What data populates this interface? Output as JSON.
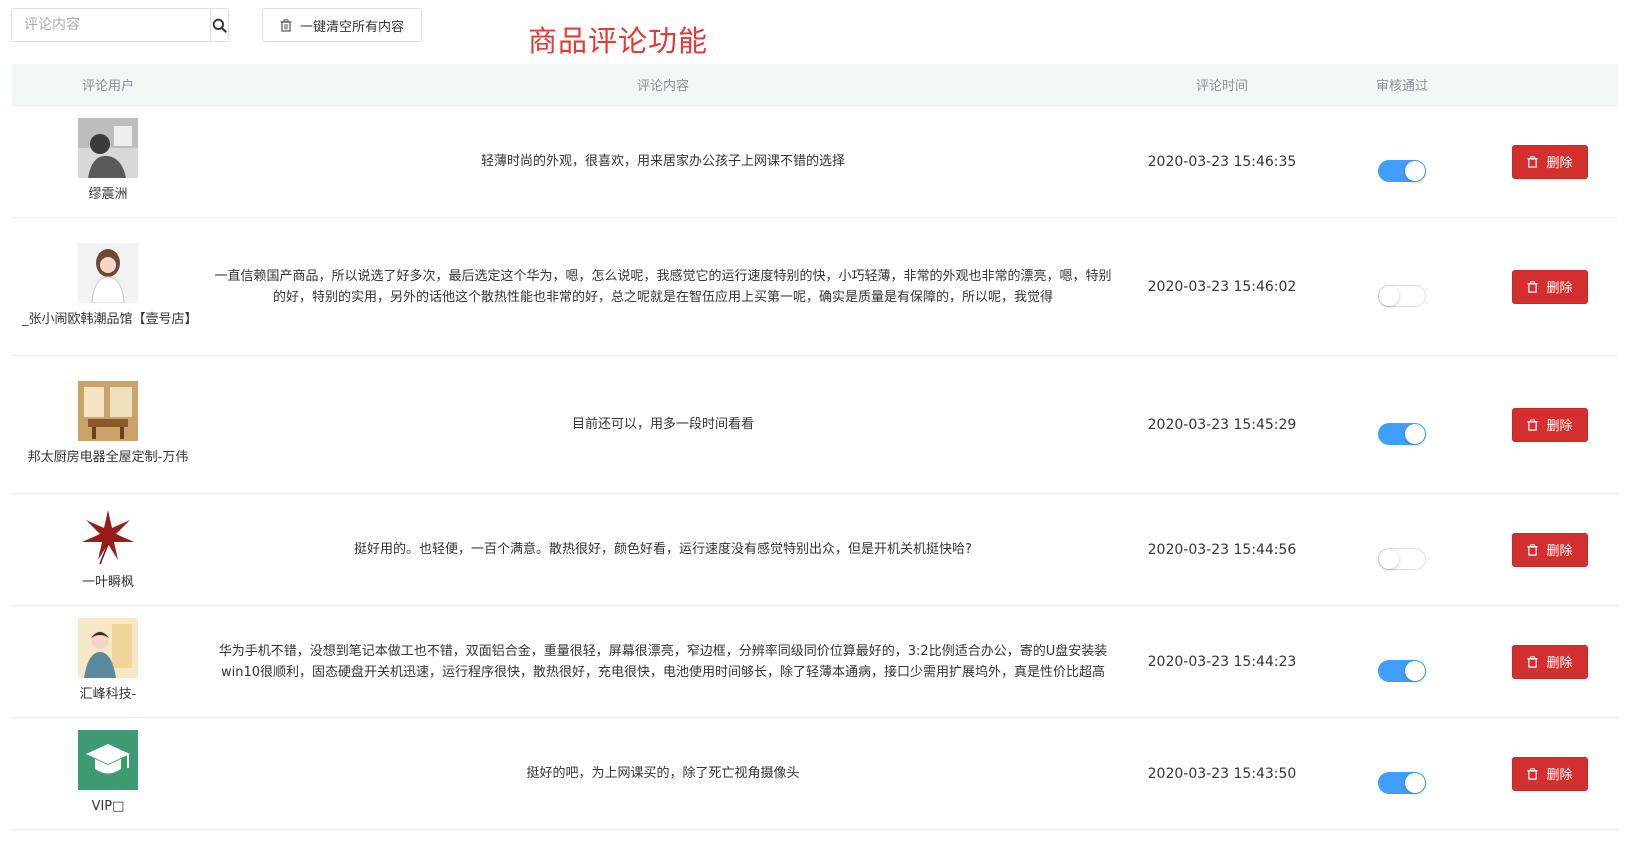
{
  "search": {
    "placeholder": "评论内容",
    "icon": "search-icon"
  },
  "toolbar": {
    "clear_label": "一键清空所有内容",
    "clear_icon": "trash-icon"
  },
  "page_title": "商品评论功能",
  "table": {
    "headers": {
      "user": "评论用户",
      "content": "评论内容",
      "time": "评论时间",
      "audit": "审核通过"
    },
    "delete_label": "删除",
    "rows": [
      {
        "user": "缪震洲",
        "content": "轻薄时尚的外观，很喜欢，用来居家办公孩子上网课不错的选择",
        "time": "2020-03-23 15:46:35",
        "approved": true
      },
      {
        "user": "_张小闹欧韩潮品馆【壹号店】",
        "content": "一直信赖国产商品，所以说选了好多次，最后选定这个华为，嗯，怎么说呢，我感觉它的运行速度特别的快，小巧轻薄，非常的外观也非常的漂亮，嗯，特别的好，特别的实用，另外的话他这个散热性能也非常的好，总之呢就是在智伍应用上买第一呢，确实是质量是有保障的，所以呢，我觉得",
        "time": "2020-03-23 15:46:02",
        "approved": false
      },
      {
        "user": "邦太厨房电器全屋定制-万伟",
        "content": "目前还可以，用多一段时间看看",
        "time": "2020-03-23 15:45:29",
        "approved": true
      },
      {
        "user": "一叶瞬枫",
        "content": "挺好用的。也轻便，一百个满意。散热很好，颜色好看，运行速度没有感觉特别出众，但是开机关机挺快哈?",
        "time": "2020-03-23 15:44:56",
        "approved": false
      },
      {
        "user": "汇峰科技-",
        "content": "华为手机不错，没想到笔记本做工也不错，双面铝合金，重量很轻，屏幕很漂亮，窄边框，分辨率同级同价位算最好的，3:2比例适合办公，寄的U盘安装装win10很顺利，固态硬盘开关机迅速，运行程序很快，散热很好，充电很快，电池使用时间够长，除了轻薄本通病，接口少需用扩展坞外，真是性价比超高",
        "time": "2020-03-23 15:44:23",
        "approved": true
      },
      {
        "user": "VIP□",
        "content": "挺好的吧，为上网课买的，除了死亡视角摄像头",
        "time": "2020-03-23 15:43:50",
        "approved": true
      }
    ]
  },
  "colors": {
    "title": "#e53935",
    "delete": "#d32f2f",
    "switch_on": "#409eff",
    "header_bg": "#f0f7f4"
  }
}
